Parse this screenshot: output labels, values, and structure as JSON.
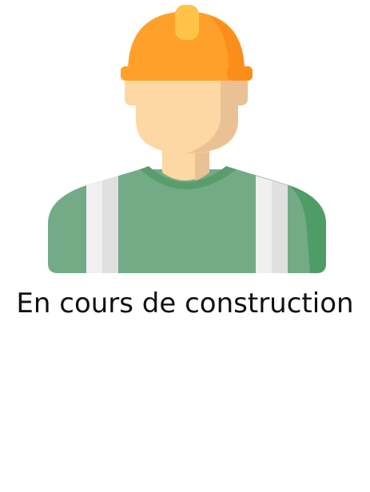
{
  "caption": "En cours de construction",
  "illustration": {
    "icon": "construction-worker-icon",
    "colors": {
      "helmet": "#ffa02a",
      "helmet_shade": "#fb8e1a",
      "helmet_top": "#ffc447",
      "skin": "#fdd7a4",
      "skin_shade": "#eac195",
      "shirt": "#74ab87",
      "shirt_shade": "#4e9d67",
      "collar": "#5b9c6c",
      "stripe": "#f0f0f0",
      "stripe_shade": "#e0e0e0"
    }
  }
}
